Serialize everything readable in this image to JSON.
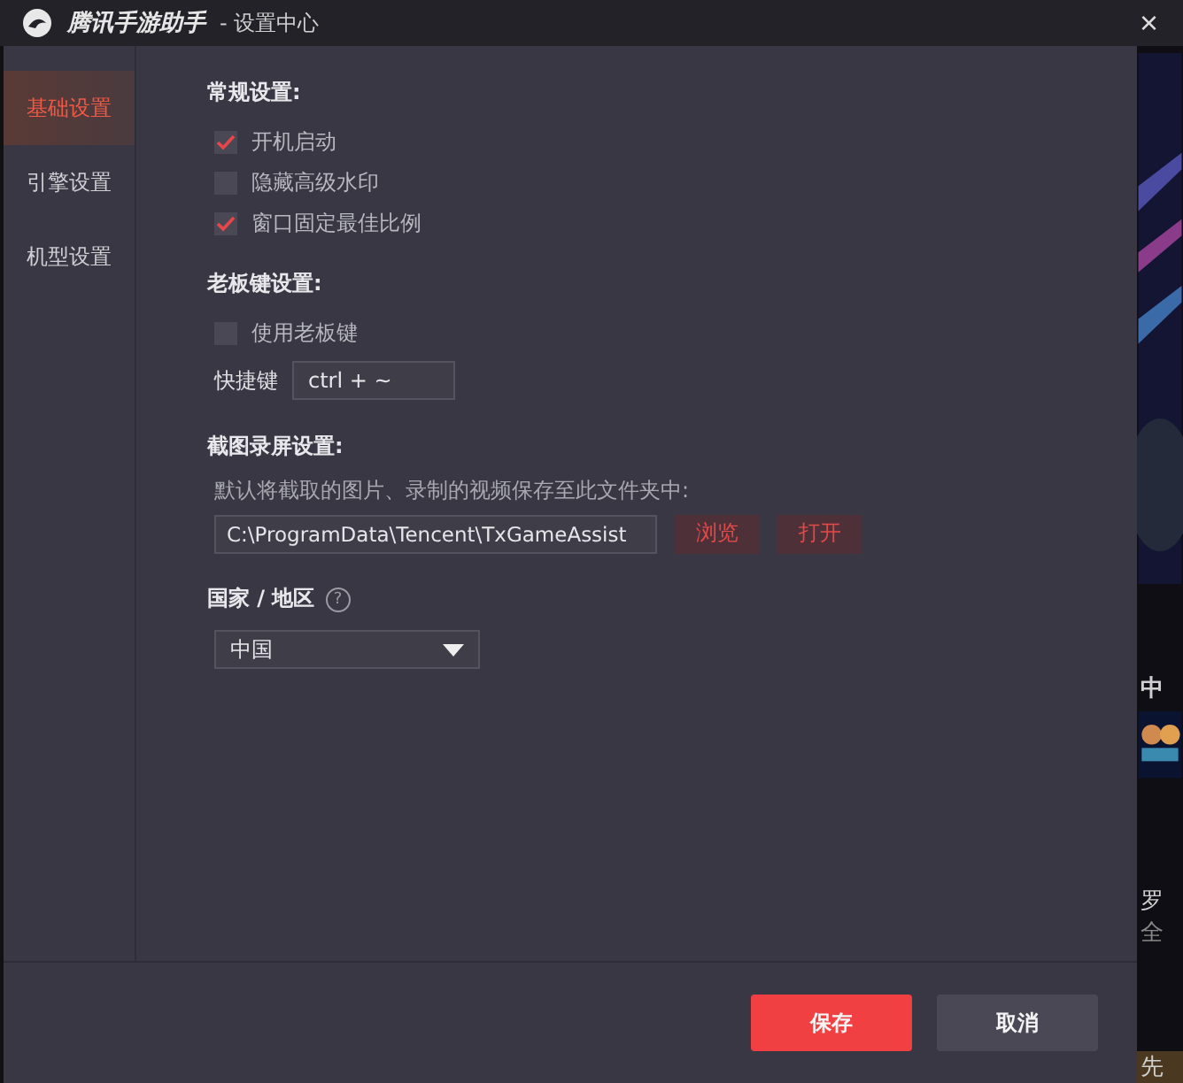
{
  "window": {
    "app_name": "腾讯手游助手",
    "title": "- 设置中心",
    "close": "×"
  },
  "sidebar": {
    "items": [
      {
        "label": "基础设置",
        "selected": true
      },
      {
        "label": "引擎设置",
        "selected": false
      },
      {
        "label": "机型设置",
        "selected": false
      }
    ]
  },
  "general": {
    "heading": "常规设置:",
    "options": [
      {
        "label": "开机启动",
        "checked": true
      },
      {
        "label": "隐藏高级水印",
        "checked": false
      },
      {
        "label": "窗口固定最佳比例",
        "checked": true
      }
    ]
  },
  "boss_key": {
    "heading": "老板键设置:",
    "option": {
      "label": "使用老板键",
      "checked": false
    },
    "shortcut_label": "快捷键",
    "shortcut_value": "ctrl + ~"
  },
  "capture": {
    "heading": "截图录屏设置:",
    "description": "默认将截取的图片、录制的视频保存至此文件夹中:",
    "path": "C:\\ProgramData\\Tencent\\TxGameAssist",
    "browse": "浏览",
    "open": "打开"
  },
  "region": {
    "heading": "国家 / 地区",
    "help": "?",
    "value": "中国"
  },
  "buttons": {
    "save": "保存",
    "cancel": "取消"
  },
  "background_app": {
    "texts": [
      "中",
      "罗",
      "全",
      "先"
    ]
  }
}
